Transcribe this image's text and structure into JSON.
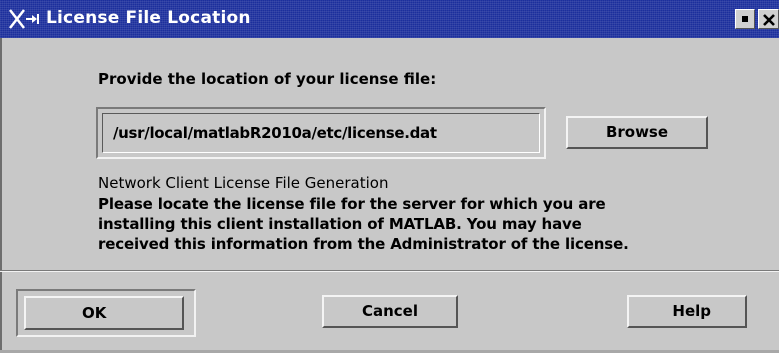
{
  "window": {
    "title": "License File Location"
  },
  "dialog": {
    "prompt_label": "Provide the location of your license file:",
    "path_value": "/usr/local/matlabR2010a/etc/license.dat",
    "browse_label": "Browse",
    "description_title": "Network Client License File Generation",
    "description_lines": [
      "Please locate the license file for the server for which you are",
      "installing this client installation of MATLAB.  You may have",
      "received this information from the Administrator of the license."
    ]
  },
  "footer": {
    "ok_label": "OK",
    "cancel_label": "Cancel",
    "help_label": "Help"
  },
  "icons": {
    "window_menu": "x-window-menu-icon",
    "minimize": "minimize-icon",
    "close": "close-icon"
  },
  "colors": {
    "titlebar": "#1c2f9c",
    "background": "#c8c8c8",
    "text": "#000000"
  }
}
